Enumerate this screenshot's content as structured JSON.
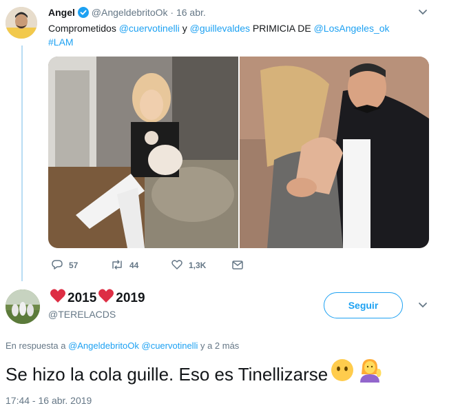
{
  "tweet1": {
    "name": "Angel",
    "handle": "@AngeldebritoOk",
    "separator": "·",
    "date": "16 abr.",
    "text_prefix": "Comprometidos ",
    "mention1": "@cuervotinelli",
    "text_mid1": " y ",
    "mention2": "@guillevaldes",
    "text_mid2": " PRIMICIA DE ",
    "mention3": "@LosAngeles_ok",
    "hashtag": "#LAM",
    "replies": "57",
    "retweets": "44",
    "likes": "1,3K",
    "icons": [
      "verified-badge-icon",
      "chevron-down-icon",
      "reply-icon",
      "retweet-icon",
      "heart-icon",
      "message-icon"
    ]
  },
  "tweet2": {
    "year1": "2015",
    "year2": "2019",
    "handle": "@TERELACDS",
    "follow_label": "Seguir",
    "reply_prefix": "En respuesta a ",
    "reply_mention1": "@AngeldebritoOk",
    "reply_mention2": "@cuervotinelli",
    "reply_suffix": " y a 2 más",
    "text": "Se hizo la cola guille. Eso es Tinellizarse",
    "time": "17:44 - 16 abr. 2019",
    "icons": [
      "red-heart-icon",
      "chevron-down-icon",
      "no-mouth-face-icon",
      "person-tipping-hand-icon"
    ]
  },
  "colors": {
    "link": "#1da1f2",
    "secondary_text": "#657786",
    "primary_text": "#14171a",
    "thread_line": "#b8dcf3",
    "heart_red": "#dd2e44"
  }
}
